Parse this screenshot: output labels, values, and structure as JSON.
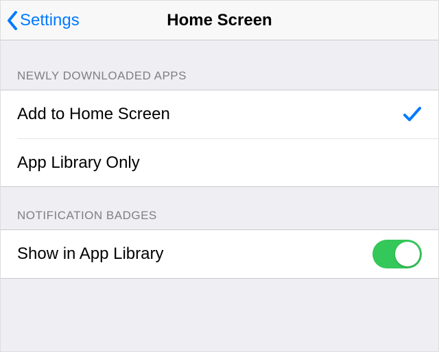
{
  "nav": {
    "back_label": "Settings",
    "title": "Home Screen"
  },
  "sections": {
    "newly_downloaded": {
      "header": "NEWLY DOWNLOADED APPS",
      "options": [
        {
          "label": "Add to Home Screen",
          "selected": true
        },
        {
          "label": "App Library Only",
          "selected": false
        }
      ]
    },
    "notification_badges": {
      "header": "NOTIFICATION BADGES",
      "row_label": "Show in App Library",
      "toggle_on": true
    }
  },
  "colors": {
    "tint": "#007aff",
    "toggle_on": "#34c759"
  }
}
